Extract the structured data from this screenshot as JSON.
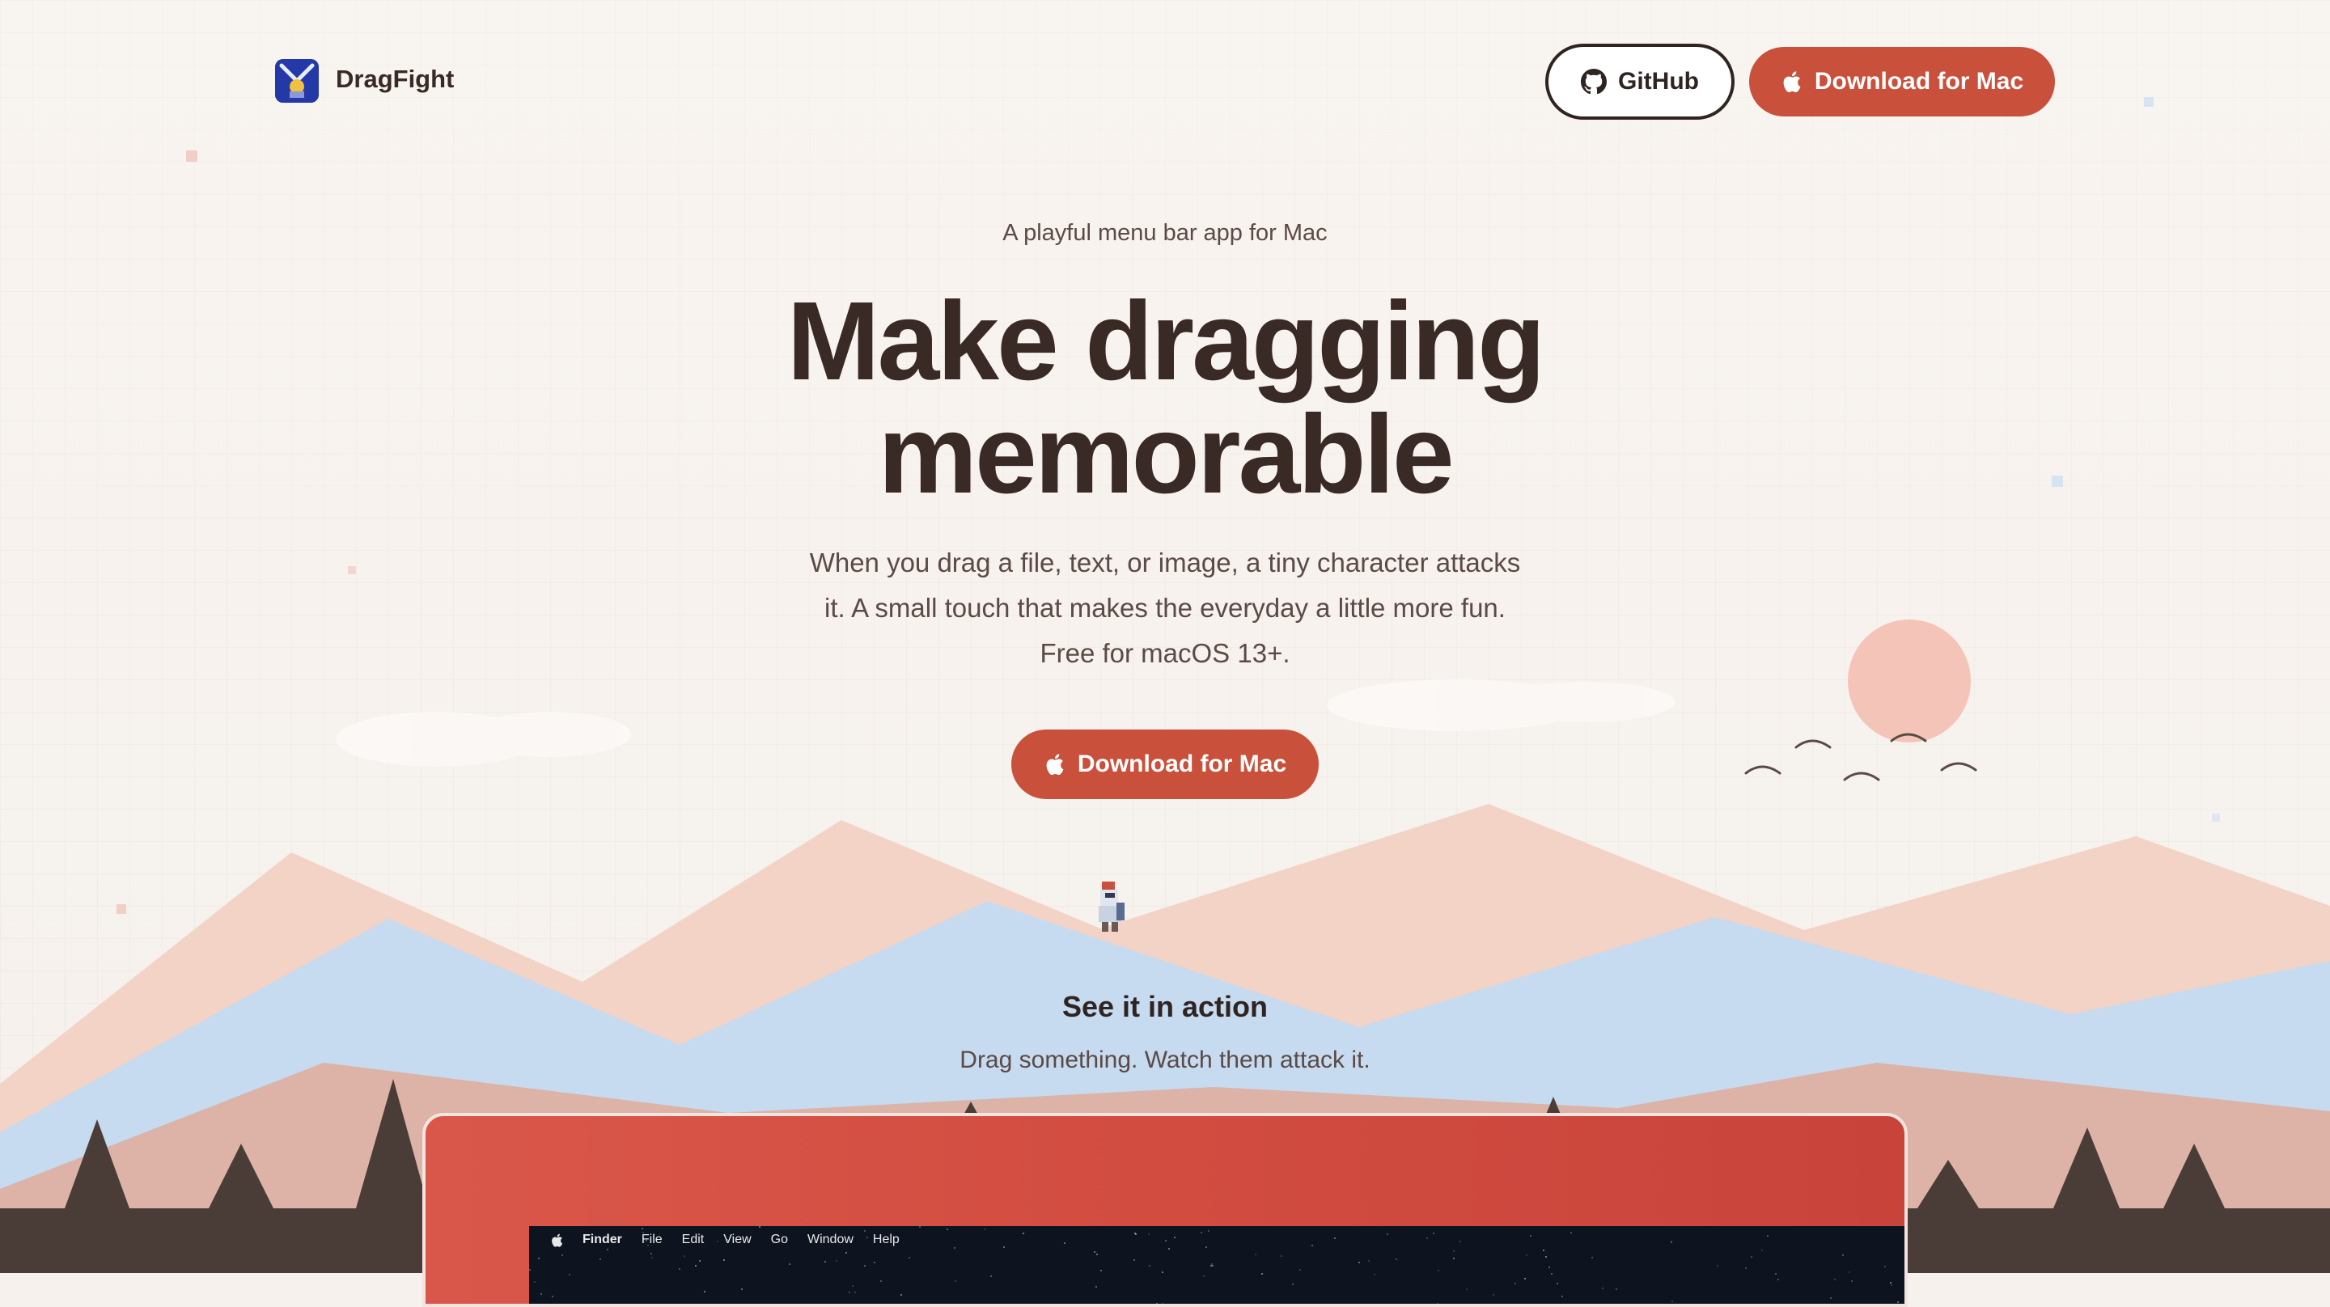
{
  "header": {
    "brand": "DragFight",
    "github_label": "GitHub",
    "download_label": "Download for Mac"
  },
  "hero": {
    "tagline": "A playful menu bar app for Mac",
    "headline_line1": "Make dragging",
    "headline_line2": "memorable",
    "description": "When you drag a file, text, or image, a tiny character attacks it. A small touch that makes the everyday a little more fun. Free for macOS 13+.",
    "download_label": "Download for Mac"
  },
  "action": {
    "title": "See it in action",
    "subtitle": "Drag something. Watch them attack it."
  },
  "demo_menubar": {
    "app": "Finder",
    "items": [
      "File",
      "Edit",
      "View",
      "Go",
      "Window",
      "Help"
    ]
  },
  "colors": {
    "accent": "#c9503b",
    "text_dark": "#3a2a26",
    "mountain_back": "#f2d3c6",
    "mountain_mid": "#c6daf0",
    "mountain_front": "#dcb3a6",
    "ground": "#4a3d38",
    "sun": "#f4c4b8"
  },
  "icons": [
    "app-logo-icon",
    "github-icon",
    "apple-icon",
    "knight-character-icon",
    "bird-icon",
    "cloud-icon",
    "sun-icon",
    "tree-icon"
  ]
}
